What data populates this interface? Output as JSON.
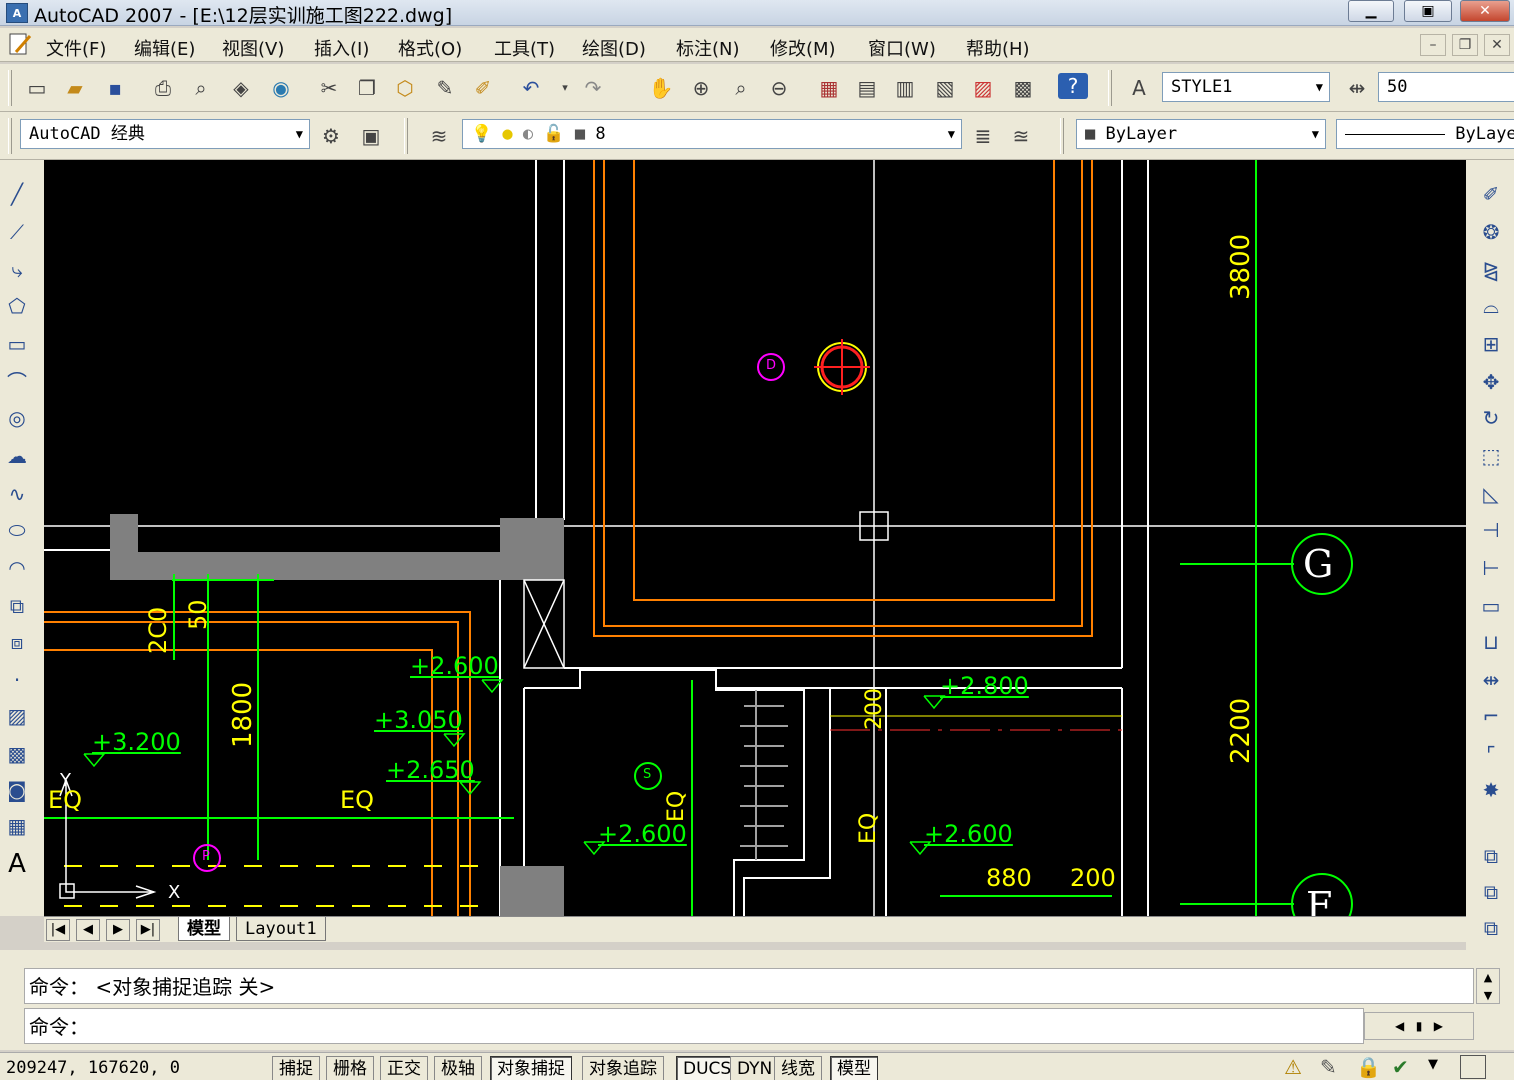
{
  "window": {
    "title": "AutoCAD 2007 - [E:\\12层实训施工图222.dwg]",
    "app_icon": "autocad-icon"
  },
  "menu": {
    "items": [
      "文件(F)",
      "编辑(E)",
      "视图(V)",
      "插入(I)",
      "格式(O)",
      "工具(T)",
      "绘图(D)",
      "标注(N)",
      "修改(M)",
      "窗口(W)",
      "帮助(H)"
    ]
  },
  "toolbar": {
    "text_style": "STYLE1",
    "dim_value": "50",
    "workspace": "AutoCAD 经典",
    "layer": "8",
    "color": "ByLayer",
    "linetype": "ByLayer"
  },
  "drawing": {
    "elevations": [
      "+2.600",
      "+3.050",
      "+2.650",
      "+3.200",
      "+2.600",
      "+2.600",
      "+2.800"
    ],
    "dimensions": [
      "3800",
      "2200",
      "1800",
      "2C0",
      "50",
      "880",
      "200",
      "200"
    ],
    "text_labels": [
      "EQ",
      "EQ",
      "EQ",
      "EQ"
    ],
    "axis_labels": [
      "G",
      "F"
    ],
    "small_markers": [
      "D",
      "S",
      "P"
    ],
    "ucs_x": "X",
    "ucs_y": "Y",
    "colors": {
      "background": "#000000",
      "wall": "#ffffff",
      "dimension": "#00ff00",
      "text": "#ffff00",
      "fill": "#808080",
      "orange": "#ff8000"
    }
  },
  "tabs": {
    "model": "模型",
    "layout1": "Layout1"
  },
  "command": {
    "history": "命令：  <对象捕捉追踪 关>",
    "prompt": "命令："
  },
  "status": {
    "coords": "209247, 167620, 0",
    "buttons": [
      "捕捉",
      "栅格",
      "正交",
      "极轴",
      "对象捕捉",
      "对象追踪",
      "DUCS",
      "DYN",
      "线宽",
      "模型"
    ],
    "active": [
      "对象捕捉",
      "DUCS",
      "模型"
    ]
  }
}
